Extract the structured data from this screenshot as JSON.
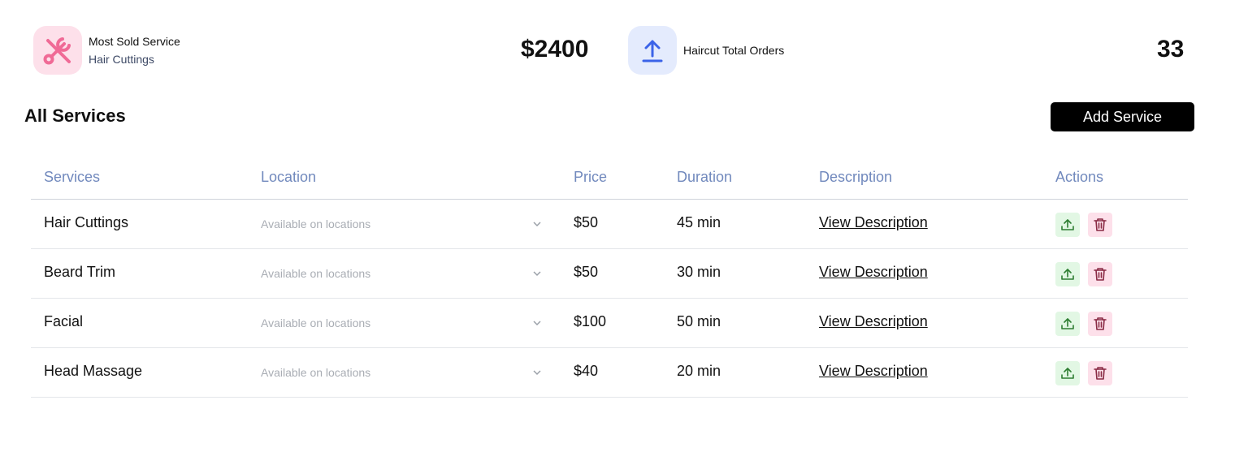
{
  "stats": {
    "most_sold": {
      "label": "Most Sold Service",
      "service": "Hair Cuttings",
      "value": "$2400",
      "icon": "tools-icon",
      "icon_color": "#f06a96"
    },
    "orders": {
      "label": "Haircut Total Orders",
      "value": "33",
      "icon": "upload-arrow-icon",
      "icon_color": "#3b63e8"
    }
  },
  "section": {
    "title": "All Services",
    "add_button": "Add Service"
  },
  "table": {
    "columns": [
      "Services",
      "Location",
      "Price",
      "Duration",
      "Description",
      "Actions"
    ],
    "location_placeholder": "Available on locations",
    "description_link": "View Description",
    "rows": [
      {
        "service": "Hair Cuttings",
        "price": "$50",
        "duration": "45 min"
      },
      {
        "service": "Beard Trim",
        "price": "$50",
        "duration": "30 min"
      },
      {
        "service": "Facial",
        "price": "$100",
        "duration": "50 min"
      },
      {
        "service": "Head Massage",
        "price": "$40",
        "duration": "20 min"
      }
    ]
  },
  "colors": {
    "header_text": "#7189bd",
    "upload_action": "#2e7d32",
    "delete_action": "#8a2b45"
  }
}
